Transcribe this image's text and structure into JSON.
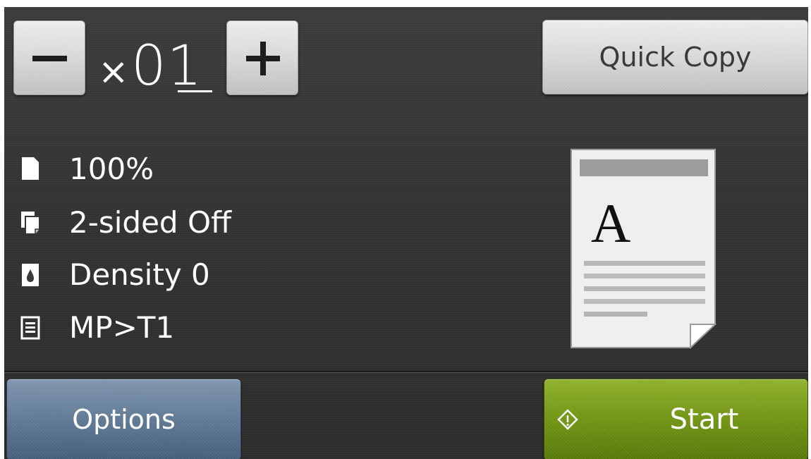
{
  "copy_counter": {
    "decrement_symbol": "−",
    "increment_symbol": "+",
    "multiplier_prefix": "×",
    "count": "01"
  },
  "quick_copy": {
    "label": "Quick Copy"
  },
  "settings": [
    {
      "icon": "page-icon",
      "label": "100%"
    },
    {
      "icon": "duplex-pages-icon",
      "label": "2-sided Off"
    },
    {
      "icon": "ink-drop-icon",
      "label": "Density 0"
    },
    {
      "icon": "paper-tray-icon",
      "label": "MP>T1"
    }
  ],
  "preview": {
    "icon": "document-preview-icon",
    "letter": "A"
  },
  "footer": {
    "options_label": "Options",
    "start_label": "Start",
    "start_icon": "start-diamond-icon"
  },
  "colors": {
    "screen_background": "#333333",
    "options_button": "#5e7894",
    "start_button": "#6f9412",
    "light_button": "#d4d4d4"
  }
}
